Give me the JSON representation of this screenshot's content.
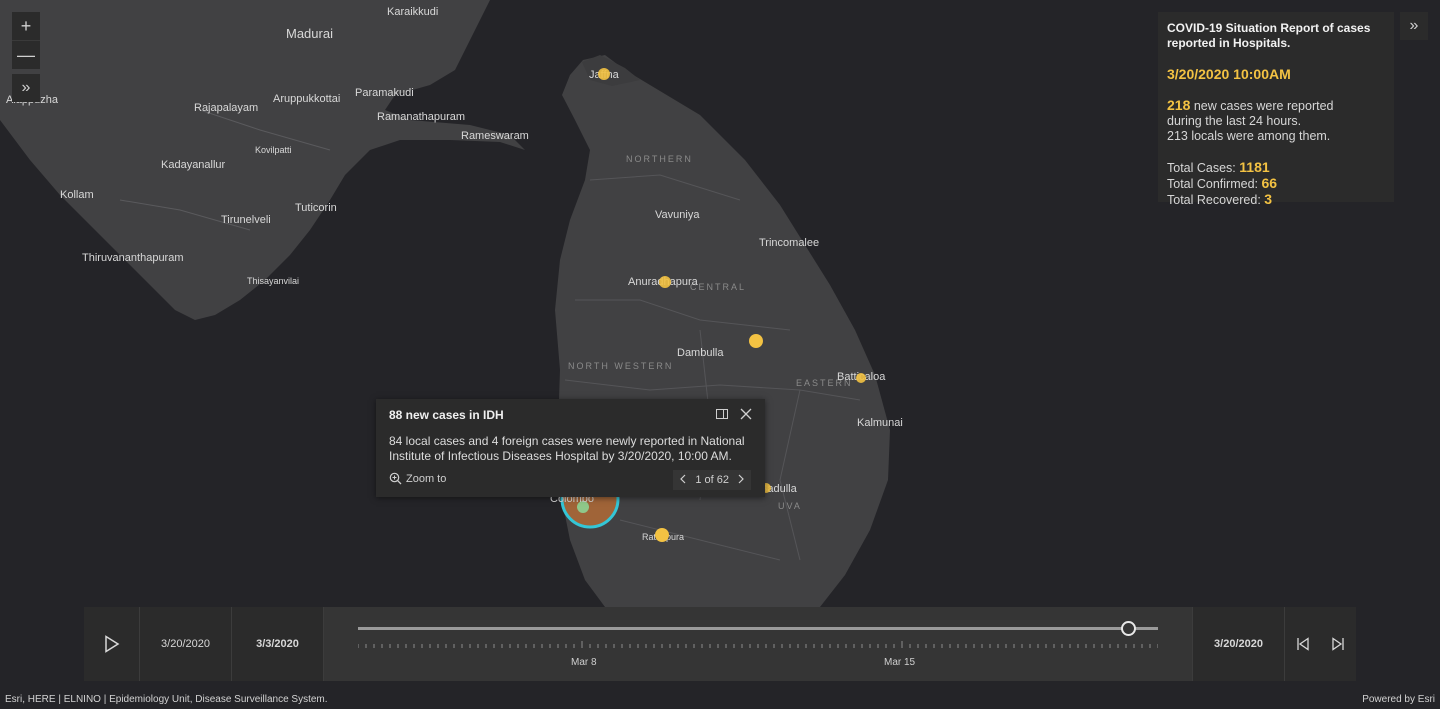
{
  "map": {
    "places": {
      "karaikkudi": "Karaikkudi",
      "madurai": "Madurai",
      "alappuzha": "Alappuzha",
      "rajapalayam": "Rajapalayam",
      "aruppukkottai": "Aruppukkottai",
      "paramakudi": "Paramakudi",
      "ramanathapuram": "Ramanathapuram",
      "rameswaram": "Rameswaram",
      "kovilpatti": "Kovilpatti",
      "kadayanallur": "Kadayanallur",
      "kollam": "Kollam",
      "tirunelveli": "Tirunelveli",
      "tuticorin": "Tuticorin",
      "thiruvananthapuram": "Thiruvananthapuram",
      "thisayanvilai": "Thisayanvilai",
      "jaffna": "Jaffna",
      "vavuniya": "Vavuniya",
      "trincomalee": "Trincomalee",
      "anuradhapura": "Anuradhapura",
      "dambulla": "Dambulla",
      "batticaloa": "Batticaloa",
      "kalmunai": "Kalmunai",
      "colombo": "Colombo",
      "ratnapura": "Ratnapura",
      "badulla": "Badulla"
    },
    "regions": {
      "northern": "NORTHERN",
      "north_central": "CENTRAL",
      "north_western": "NORTH WESTERN",
      "eastern": "EASTERN",
      "uva": "UVA"
    },
    "colors": {
      "water": "#242428",
      "land": "#414143",
      "case_marker": "#f3c243",
      "selected_ring": "#34c6d6"
    }
  },
  "controls": {
    "zoom_in": "+",
    "zoom_out": "—",
    "expand": "»",
    "collapse": "»"
  },
  "report": {
    "title": "COVID-19 Situation Report of cases reported in Hospitals.",
    "date": "3/20/2020 10:00AM",
    "new_cases": "218",
    "new_cases_text_1": "new cases were reported",
    "new_cases_text_2": "during the last 24 hours.",
    "locals_text": "213 locals were among them.",
    "total_cases_label": "Total Cases:",
    "total_cases": "1181",
    "total_confirmed_label": "Total Confirmed:",
    "total_confirmed": "66",
    "total_recovered_label": "Total Recovered:",
    "total_recovered": "3"
  },
  "popup": {
    "title": "88 new cases in IDH",
    "body": "84 local cases and 4 foreign cases were newly reported in National Institute of Infectious Diseases Hospital by 3/20/2020, 10:00 AM.",
    "zoom_to": "Zoom to",
    "pager": "1 of 62"
  },
  "timeslider": {
    "current_date": "3/20/2020",
    "start_date": "3/3/2020",
    "end_date": "3/20/2020",
    "tick_labels": [
      "Mar 8",
      "Mar 15"
    ],
    "progress": 1.0
  },
  "footer": {
    "attribution": "Esri, HERE | ELNINO | Epidemiology Unit, Disease Surveillance System.",
    "powered_by": "Powered by Esri"
  }
}
